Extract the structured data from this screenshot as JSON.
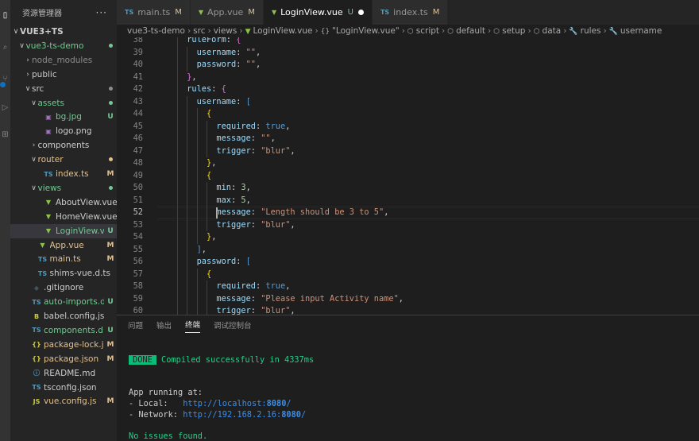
{
  "activity": {
    "badge_count": "1"
  },
  "sidebar": {
    "title": "资源管理器",
    "more": "···",
    "rows": [
      {
        "indent": 0,
        "twisty": "∨",
        "icon": "",
        "icon_color": "",
        "name": "VUE3+TS",
        "badge": "",
        "color": "#cccccc",
        "dot": false,
        "bold": true
      },
      {
        "indent": 1,
        "twisty": "∨",
        "icon": "",
        "icon_color": "",
        "name": "vue3-ts-demo",
        "badge": "",
        "color": "#73c991",
        "dot": true
      },
      {
        "indent": 2,
        "twisty": "›",
        "icon": "",
        "icon_color": "",
        "name": "node_modules",
        "badge": "",
        "color": "#8c8c8c",
        "dot": false
      },
      {
        "indent": 2,
        "twisty": "›",
        "icon": "",
        "icon_color": "",
        "name": "public",
        "badge": "",
        "color": "#cccccc",
        "dot": false
      },
      {
        "indent": 2,
        "twisty": "∨",
        "icon": "",
        "icon_color": "",
        "name": "src",
        "badge": "",
        "color": "#cccccc",
        "dot": true,
        "dot_color": "#8c8c8c"
      },
      {
        "indent": 3,
        "twisty": "∨",
        "icon": "",
        "icon_color": "",
        "name": "assets",
        "badge": "",
        "color": "#73c991",
        "dot": true
      },
      {
        "indent": 4,
        "twisty": "",
        "icon": "▣",
        "icon_color": "#a074c4",
        "name": "bg.jpg",
        "badge": "U",
        "color": "#73c991",
        "dot": false
      },
      {
        "indent": 4,
        "twisty": "",
        "icon": "▣",
        "icon_color": "#a074c4",
        "name": "logo.png",
        "badge": "",
        "color": "#cccccc",
        "dot": false
      },
      {
        "indent": 3,
        "twisty": "›",
        "icon": "",
        "icon_color": "",
        "name": "components",
        "badge": "",
        "color": "#cccccc",
        "dot": false
      },
      {
        "indent": 3,
        "twisty": "∨",
        "icon": "",
        "icon_color": "",
        "name": "router",
        "badge": "",
        "color": "#e2c08d",
        "dot": true,
        "dot_color": "#e2c08d"
      },
      {
        "indent": 4,
        "twisty": "",
        "icon": "TS",
        "icon_color": "#519aba",
        "name": "index.ts",
        "badge": "M",
        "color": "#e2c08d",
        "dot": false
      },
      {
        "indent": 3,
        "twisty": "∨",
        "icon": "",
        "icon_color": "",
        "name": "views",
        "badge": "",
        "color": "#73c991",
        "dot": true
      },
      {
        "indent": 4,
        "twisty": "",
        "icon": "▼",
        "icon_color": "#8dc149",
        "name": "AboutView.vue",
        "badge": "",
        "color": "#cccccc",
        "dot": false
      },
      {
        "indent": 4,
        "twisty": "",
        "icon": "▼",
        "icon_color": "#8dc149",
        "name": "HomeView.vue",
        "badge": "",
        "color": "#cccccc",
        "dot": false
      },
      {
        "indent": 4,
        "twisty": "",
        "icon": "▼",
        "icon_color": "#8dc149",
        "name": "LoginView.vue",
        "badge": "U",
        "color": "#73c991",
        "dot": false,
        "selected": true
      },
      {
        "indent": 3,
        "twisty": "",
        "icon": "▼",
        "icon_color": "#8dc149",
        "name": "App.vue",
        "badge": "M",
        "color": "#e2c08d",
        "dot": false
      },
      {
        "indent": 3,
        "twisty": "",
        "icon": "TS",
        "icon_color": "#519aba",
        "name": "main.ts",
        "badge": "M",
        "color": "#e2c08d",
        "dot": false
      },
      {
        "indent": 3,
        "twisty": "",
        "icon": "TS",
        "icon_color": "#519aba",
        "name": "shims-vue.d.ts",
        "badge": "",
        "color": "#cccccc",
        "dot": false
      },
      {
        "indent": 2,
        "twisty": "",
        "icon": "◆",
        "icon_color": "#41535b",
        "name": ".gitignore",
        "badge": "",
        "color": "#cccccc",
        "dot": false
      },
      {
        "indent": 2,
        "twisty": "",
        "icon": "TS",
        "icon_color": "#519aba",
        "name": "auto-imports.d.ts",
        "badge": "U",
        "color": "#73c991",
        "dot": false
      },
      {
        "indent": 2,
        "twisty": "",
        "icon": "B",
        "icon_color": "#cbcb41",
        "name": "babel.config.js",
        "badge": "",
        "color": "#cccccc",
        "dot": false
      },
      {
        "indent": 2,
        "twisty": "",
        "icon": "TS",
        "icon_color": "#519aba",
        "name": "components.d.ts",
        "badge": "U",
        "color": "#73c991",
        "dot": false
      },
      {
        "indent": 2,
        "twisty": "",
        "icon": "{}",
        "icon_color": "#cbcb41",
        "name": "package-lock.j...",
        "badge": "M",
        "color": "#e2c08d",
        "dot": false
      },
      {
        "indent": 2,
        "twisty": "",
        "icon": "{}",
        "icon_color": "#cbcb41",
        "name": "package.json",
        "badge": "M",
        "color": "#e2c08d",
        "dot": false
      },
      {
        "indent": 2,
        "twisty": "",
        "icon": "ⓘ",
        "icon_color": "#519aba",
        "name": "README.md",
        "badge": "",
        "color": "#cccccc",
        "dot": false
      },
      {
        "indent": 2,
        "twisty": "",
        "icon": "TS",
        "icon_color": "#519aba",
        "name": "tsconfig.json",
        "badge": "",
        "color": "#cccccc",
        "dot": false
      },
      {
        "indent": 2,
        "twisty": "",
        "icon": "JS",
        "icon_color": "#cbcb41",
        "name": "vue.config.js",
        "badge": "M",
        "color": "#e2c08d",
        "dot": false
      }
    ]
  },
  "tabs": [
    {
      "icon": "TS",
      "icon_color": "#519aba",
      "label": "main.ts",
      "badge": "M",
      "active": false,
      "dirty": false
    },
    {
      "icon": "▼",
      "icon_color": "#8dc149",
      "label": "App.vue",
      "badge": "M",
      "active": false,
      "dirty": false
    },
    {
      "icon": "▼",
      "icon_color": "#8dc149",
      "label": "LoginView.vue",
      "badge": "U",
      "active": true,
      "dirty": true
    },
    {
      "icon": "TS",
      "icon_color": "#519aba",
      "label": "index.ts",
      "badge": "M",
      "active": false,
      "dirty": false
    }
  ],
  "breadcrumb": [
    {
      "icon": "",
      "label": "vue3-ts-demo"
    },
    {
      "icon": "",
      "label": "src"
    },
    {
      "icon": "",
      "label": "views"
    },
    {
      "icon": "▼",
      "label": "LoginView.vue"
    },
    {
      "icon": "{}",
      "label": "\"LoginView.vue\""
    },
    {
      "icon": "⬡",
      "label": "script"
    },
    {
      "icon": "⬡",
      "label": "default"
    },
    {
      "icon": "⬡",
      "label": "setup"
    },
    {
      "icon": "⬡",
      "label": "data"
    },
    {
      "icon": "🔧",
      "label": "rules"
    },
    {
      "icon": "🔧",
      "label": "username"
    }
  ],
  "editor": {
    "current_line": 52,
    "lines": [
      {
        "n": 38,
        "ind": 3,
        "t": [
          [
            "k",
            "ruleForm"
          ],
          [
            "p",
            ": "
          ],
          [
            "m",
            "{"
          ]
        ]
      },
      {
        "n": 39,
        "ind": 4,
        "t": [
          [
            "k",
            "username"
          ],
          [
            "p",
            ": "
          ],
          [
            "s",
            "\"\""
          ],
          [
            "p",
            ","
          ]
        ]
      },
      {
        "n": 40,
        "ind": 4,
        "t": [
          [
            "k",
            "password"
          ],
          [
            "p",
            ": "
          ],
          [
            "s",
            "\"\""
          ],
          [
            "p",
            ","
          ]
        ]
      },
      {
        "n": 41,
        "ind": 3,
        "t": [
          [
            "m",
            "}"
          ],
          [
            "p",
            ","
          ]
        ]
      },
      {
        "n": 42,
        "ind": 3,
        "t": [
          [
            "k",
            "rules"
          ],
          [
            "p",
            ": "
          ],
          [
            "m",
            "{"
          ]
        ]
      },
      {
        "n": 43,
        "ind": 4,
        "t": [
          [
            "k",
            "username"
          ],
          [
            "p",
            ": "
          ],
          [
            "b",
            "["
          ]
        ]
      },
      {
        "n": 44,
        "ind": 5,
        "t": [
          [
            "y",
            "{"
          ]
        ]
      },
      {
        "n": 45,
        "ind": 6,
        "t": [
          [
            "k",
            "required"
          ],
          [
            "p",
            ": "
          ],
          [
            "b",
            "true"
          ],
          [
            "p",
            ","
          ]
        ]
      },
      {
        "n": 46,
        "ind": 6,
        "t": [
          [
            "k",
            "message"
          ],
          [
            "p",
            ": "
          ],
          [
            "s",
            "\"\""
          ],
          [
            "p",
            ","
          ]
        ]
      },
      {
        "n": 47,
        "ind": 6,
        "t": [
          [
            "k",
            "trigger"
          ],
          [
            "p",
            ": "
          ],
          [
            "s",
            "\"blur\""
          ],
          [
            "p",
            ","
          ]
        ]
      },
      {
        "n": 48,
        "ind": 5,
        "t": [
          [
            "y",
            "}"
          ],
          [
            "p",
            ","
          ]
        ]
      },
      {
        "n": 49,
        "ind": 5,
        "t": [
          [
            "y",
            "{"
          ]
        ]
      },
      {
        "n": 50,
        "ind": 6,
        "t": [
          [
            "k",
            "min"
          ],
          [
            "p",
            ": "
          ],
          [
            "n",
            "3"
          ],
          [
            "p",
            ","
          ]
        ]
      },
      {
        "n": 51,
        "ind": 6,
        "t": [
          [
            "k",
            "max"
          ],
          [
            "p",
            ": "
          ],
          [
            "n",
            "5"
          ],
          [
            "p",
            ","
          ]
        ]
      },
      {
        "n": 52,
        "ind": 6,
        "t": [
          [
            "k",
            "message"
          ],
          [
            "p",
            ": "
          ],
          [
            "s",
            "\"Length should be 3 to 5\""
          ],
          [
            "p",
            ","
          ]
        ]
      },
      {
        "n": 53,
        "ind": 6,
        "t": [
          [
            "k",
            "trigger"
          ],
          [
            "p",
            ": "
          ],
          [
            "s",
            "\"blur\""
          ],
          [
            "p",
            ","
          ]
        ]
      },
      {
        "n": 54,
        "ind": 5,
        "t": [
          [
            "y",
            "}"
          ],
          [
            "p",
            ","
          ]
        ]
      },
      {
        "n": 55,
        "ind": 4,
        "t": [
          [
            "b",
            "]"
          ],
          [
            "p",
            ","
          ]
        ]
      },
      {
        "n": 56,
        "ind": 4,
        "t": [
          [
            "k",
            "password"
          ],
          [
            "p",
            ": "
          ],
          [
            "b",
            "["
          ]
        ]
      },
      {
        "n": 57,
        "ind": 5,
        "t": [
          [
            "y",
            "{"
          ]
        ]
      },
      {
        "n": 58,
        "ind": 6,
        "t": [
          [
            "k",
            "required"
          ],
          [
            "p",
            ": "
          ],
          [
            "b",
            "true"
          ],
          [
            "p",
            ","
          ]
        ]
      },
      {
        "n": 59,
        "ind": 6,
        "t": [
          [
            "k",
            "message"
          ],
          [
            "p",
            ": "
          ],
          [
            "s",
            "\"Please input Activity name\""
          ],
          [
            "p",
            ","
          ]
        ]
      },
      {
        "n": 60,
        "ind": 6,
        "t": [
          [
            "k",
            "trigger"
          ],
          [
            "p",
            ": "
          ],
          [
            "s",
            "\"blur\""
          ],
          [
            "p",
            ","
          ]
        ]
      }
    ]
  },
  "panel": {
    "tabs": [
      {
        "label": "问题",
        "active": false
      },
      {
        "label": "输出",
        "active": false
      },
      {
        "label": "终端",
        "active": true
      },
      {
        "label": "调试控制台",
        "active": false
      }
    ],
    "terminal": {
      "done_badge": "DONE",
      "compiled": "Compiled successfully in 4337ms",
      "app_running": "App running at:",
      "local_label": "- Local:   ",
      "local_url_prefix": "http://localhost:",
      "local_port": "8080",
      "local_url_suffix": "/",
      "network_label": "- Network: ",
      "network_url_prefix": "http://192.168.2.16:",
      "network_port": "8080",
      "network_url_suffix": "/",
      "issues": "No issues found."
    }
  }
}
